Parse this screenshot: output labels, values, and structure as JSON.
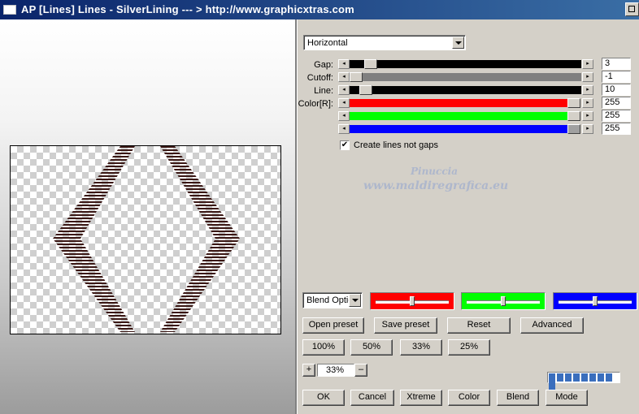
{
  "window": {
    "title": "AP [Lines]  Lines - SilverLining     --- > http://www.graphicxtras.com"
  },
  "direction": {
    "selected": "Horizontal"
  },
  "sliders": [
    {
      "label": "Gap:",
      "value": "3",
      "color": "#000000"
    },
    {
      "label": "Cutoff:",
      "value": "-1",
      "color": "#808080"
    },
    {
      "label": "Line:",
      "value": "10",
      "color": "#000000"
    },
    {
      "label": "Color[R]:",
      "value": "255",
      "color": "#ff0000"
    },
    {
      "label": "",
      "value": "255",
      "color": "#00ff00"
    },
    {
      "label": "",
      "value": "255",
      "color": "#0000ff"
    }
  ],
  "option": {
    "label": "Create lines not gaps",
    "checked": true,
    "check_mark": "✔"
  },
  "watermark": {
    "line1": "Pinuccia",
    "line2": "www.maldiregrafica.eu"
  },
  "blend": {
    "selected": "Blend Optio"
  },
  "color_swatches": [
    "#ff0000",
    "#00ff00",
    "#0000ff"
  ],
  "preset_buttons": [
    "Open preset",
    "Save preset",
    "Reset",
    "Advanced"
  ],
  "zoom_buttons": [
    "100%",
    "50%",
    "33%",
    "25%"
  ],
  "zoom": {
    "plus": "+",
    "value": "33%",
    "minus": "–"
  },
  "progress": {
    "segments": 9,
    "icon": "progress-blocks"
  },
  "bottom_buttons": [
    "OK",
    "Cancel",
    "Xtreme",
    "Color",
    "Blend",
    "Mode"
  ],
  "preview_shape": {
    "stripe_color": "#3a1714",
    "description_icon": "diamond-stripes"
  }
}
